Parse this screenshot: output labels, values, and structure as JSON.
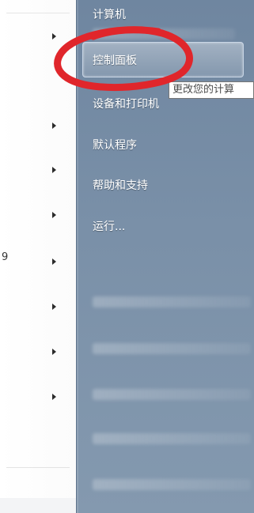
{
  "start_menu": {
    "left": {
      "partial_item_text": "9",
      "submenu_arrows": 8
    },
    "right": {
      "items": [
        {
          "label": "计算机"
        },
        {
          "label": "控制面板"
        },
        {
          "label": "设备和打印机"
        },
        {
          "label": "默认程序"
        },
        {
          "label": "帮助和支持"
        },
        {
          "label": "运行..."
        }
      ],
      "tooltip": "更改您的计算"
    },
    "annotation_color": "#e0262b",
    "accent_panel_color": "#7a90a8"
  }
}
